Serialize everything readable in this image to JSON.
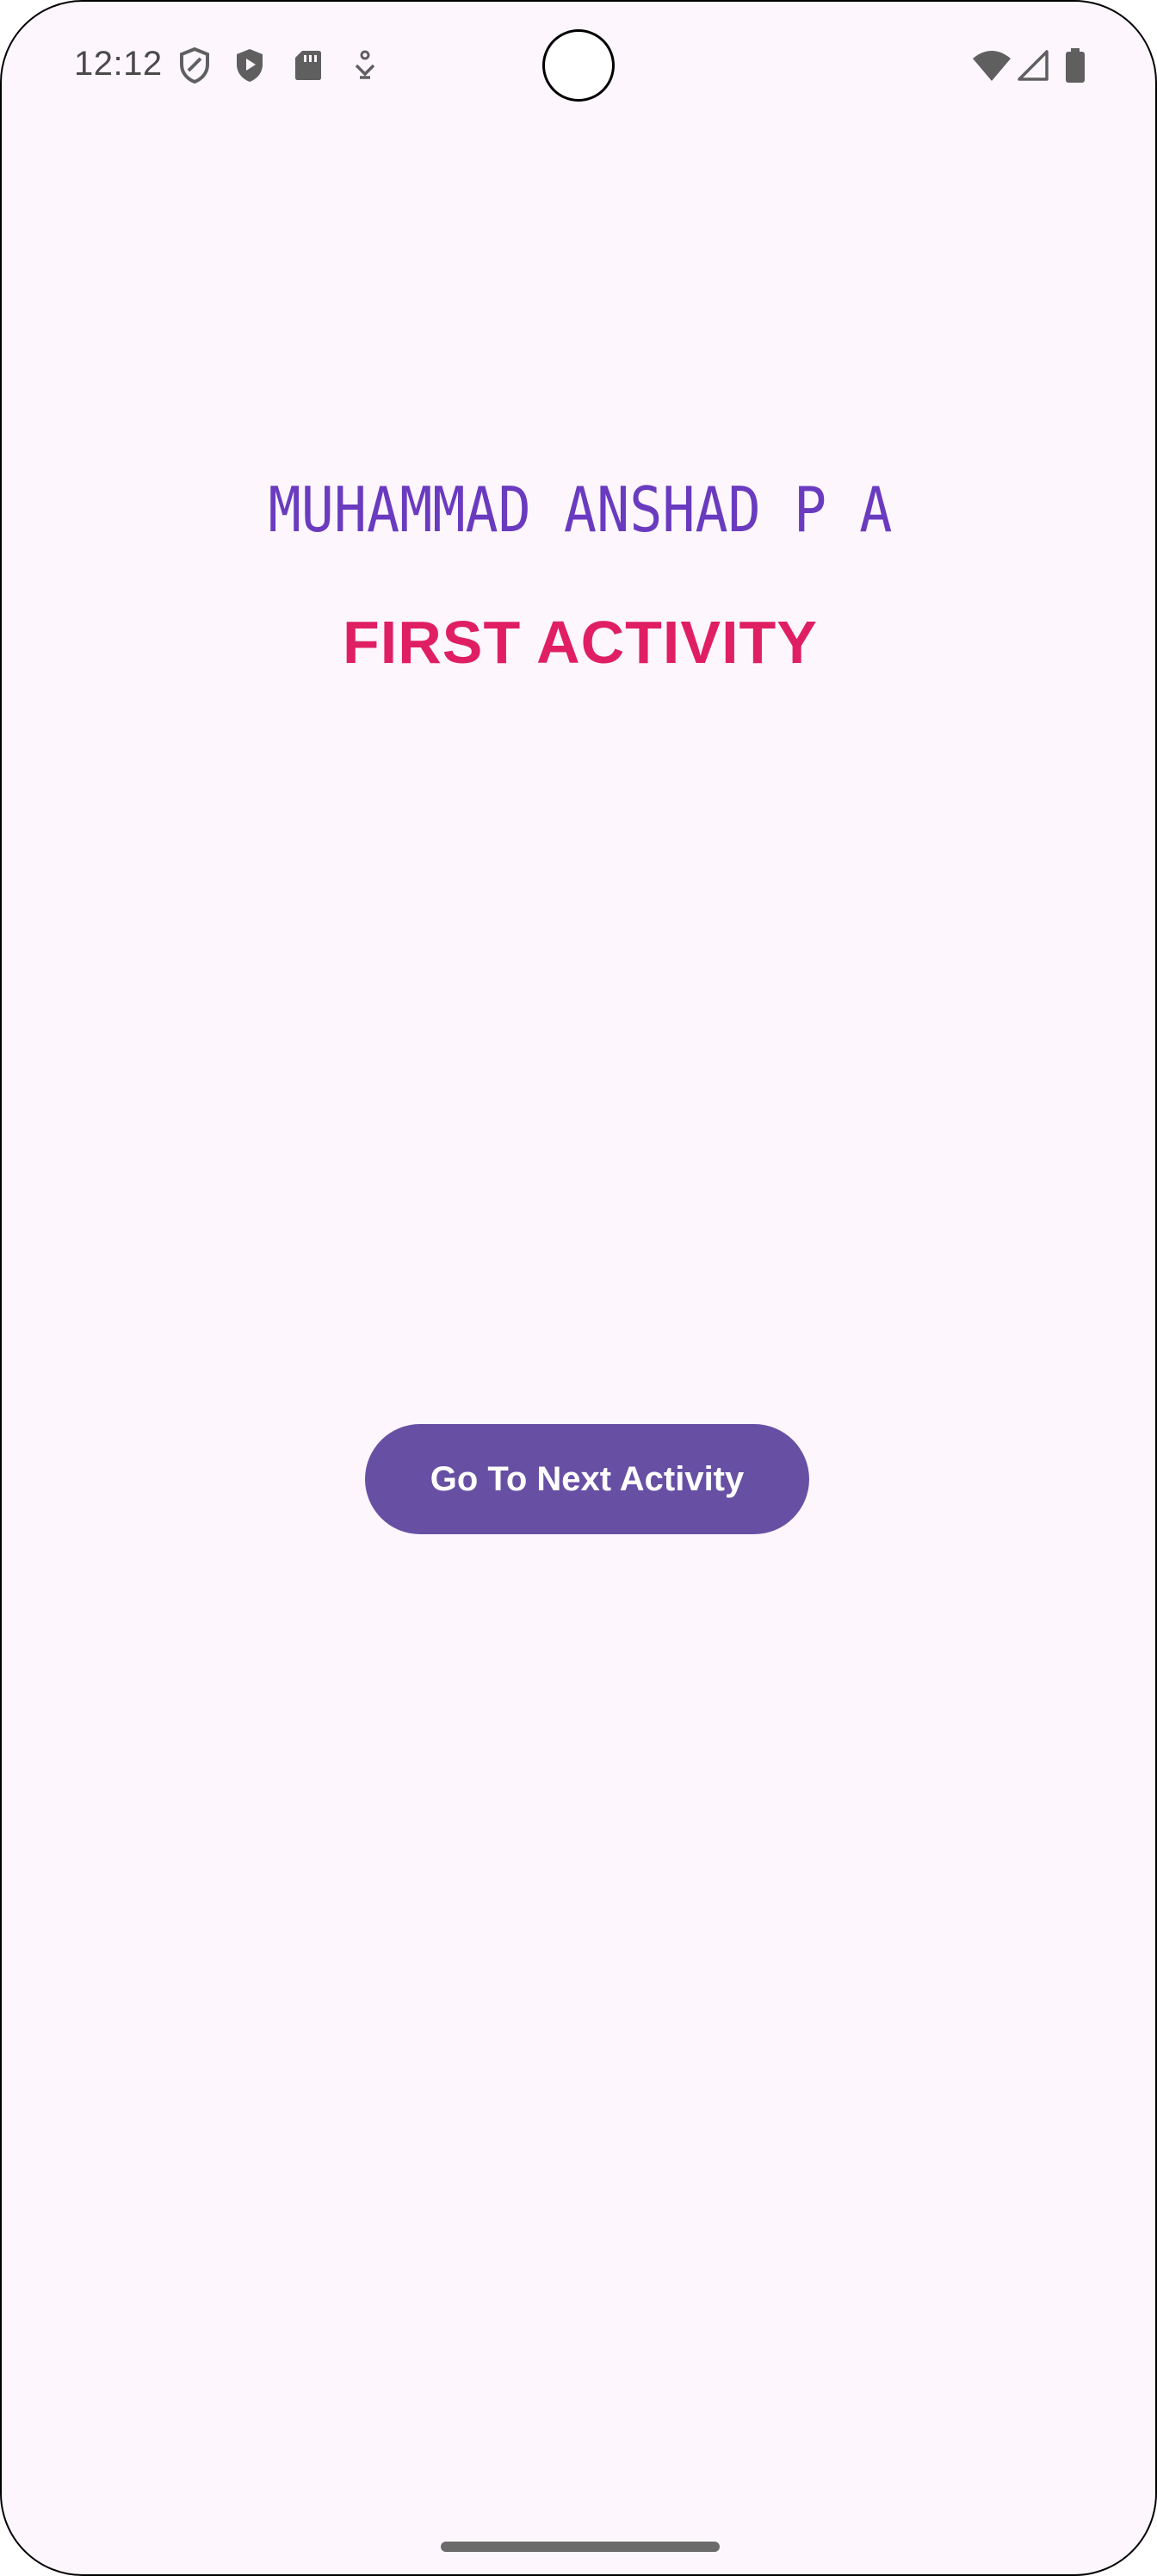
{
  "status_bar": {
    "time": "12:12",
    "left_icons": [
      "shield-outline-icon",
      "play-protect-icon",
      "sd-card-icon",
      "accessibility-download-icon"
    ],
    "right_icons": [
      "wifi-icon",
      "cellular-signal-icon",
      "battery-icon"
    ],
    "icon_color": "#5f5f5f"
  },
  "main": {
    "name": "MUHAMMAD ANSHAD P A",
    "title": "FIRST ACTIVITY",
    "button_label": "Go To Next Activity"
  },
  "colors": {
    "background": "#fdf7fd",
    "name_color": "#6a3bbf",
    "title_color": "#e01f63",
    "button_color": "#6750a4",
    "button_text_color": "#ffffff"
  }
}
